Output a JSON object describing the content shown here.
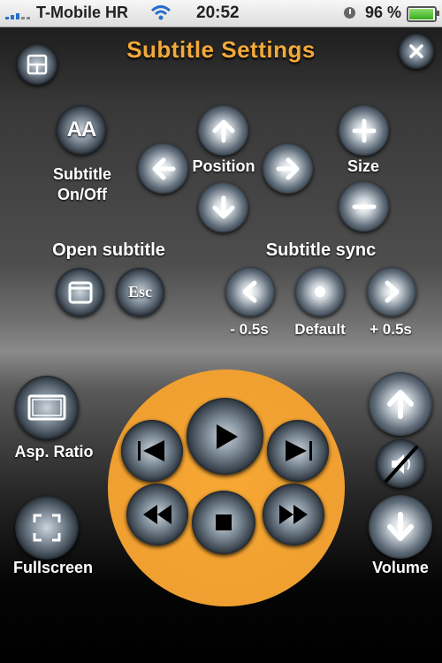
{
  "status_bar": {
    "carrier": "T-Mobile HR",
    "time": "20:52",
    "battery": "96 %",
    "battery_level_percent": 96
  },
  "title": "Subtitle Settings",
  "subtitle_section": {
    "toggle_label": "Subtitle On/Off",
    "toggle_icon_text": "AA",
    "position_label": "Position",
    "size_label": "Size",
    "open_subtitle_label": "Open subtitle",
    "esc_label": "Esc",
    "sync_label": "Subtitle sync",
    "sync_minus": "- 0.5s",
    "sync_default": "Default",
    "sync_plus": "+ 0.5s"
  },
  "playback_section": {
    "aspect_ratio_label": "Asp. Ratio",
    "fullscreen_label": "Fullscreen",
    "volume_label": "Volume"
  },
  "colors": {
    "title": "#f2a93b",
    "playback_disc": "#f0a030",
    "label": "#ffffff"
  },
  "icons": [
    "layout-icon",
    "close-icon",
    "font-size-icon",
    "arrow-up-icon",
    "arrow-left-icon",
    "arrow-right-icon",
    "arrow-down-icon",
    "plus-icon",
    "minus-icon",
    "window-icon",
    "chevron-left-icon",
    "dot-icon",
    "chevron-right-icon",
    "aspect-ratio-icon",
    "fullscreen-icon",
    "previous-icon",
    "play-icon",
    "next-icon",
    "rewind-icon",
    "stop-icon",
    "fast-forward-icon",
    "volume-up-icon",
    "mute-icon",
    "volume-down-icon"
  ]
}
